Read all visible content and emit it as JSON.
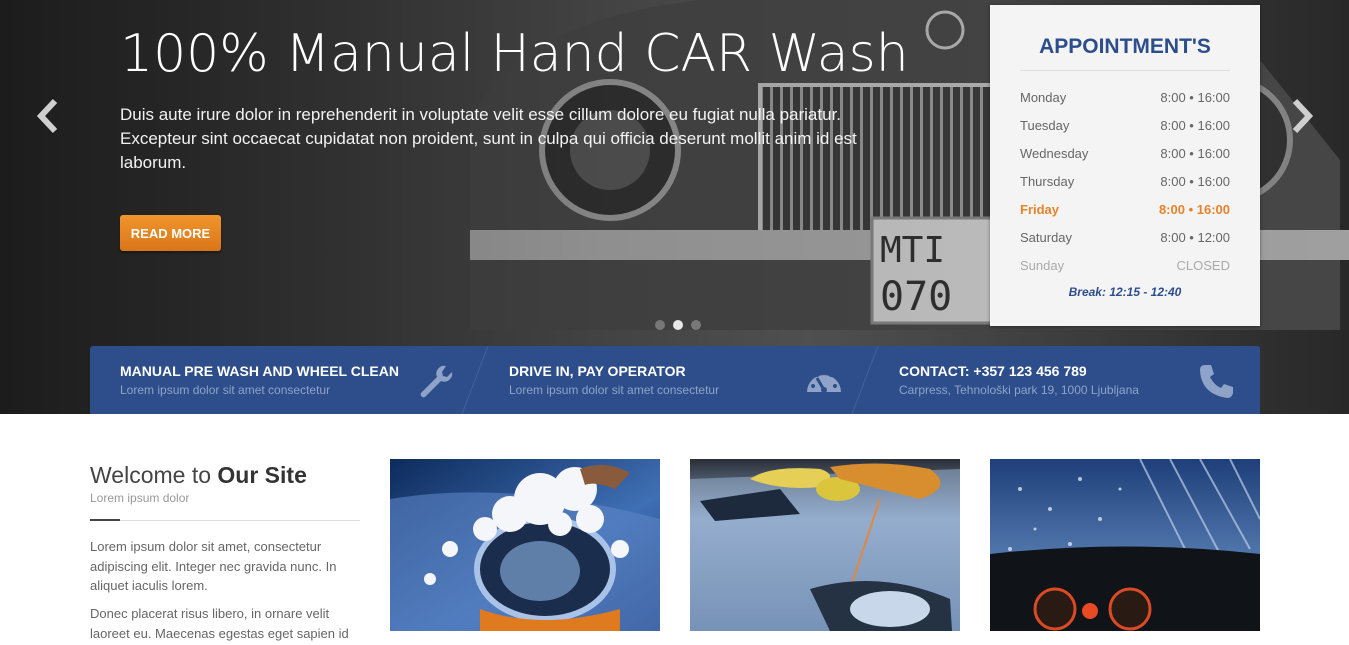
{
  "hero": {
    "title": "100% Manual Hand CAR Wash",
    "text": "Duis aute irure dolor in reprehenderit in voluptate velit esse cillum dolore eu fugiat nulla pariatur. Excepteur sint occaecat cupidatat non proident, sunt in culpa qui officia deserunt mollit anim id est laborum.",
    "button_label": "READ MORE",
    "slides": 3,
    "active_slide": 2,
    "background_image": "vintage-car-grille",
    "icons": {
      "prev": "chevron-left-icon",
      "next": "chevron-right-icon"
    }
  },
  "appointment": {
    "title": "APPOINTMENT'S",
    "days": [
      {
        "day": "Monday",
        "hours": "8:00 • 16:00"
      },
      {
        "day": "Tuesday",
        "hours": "8:00 • 16:00"
      },
      {
        "day": "Wednesday",
        "hours": "8:00 • 16:00"
      },
      {
        "day": "Thursday",
        "hours": "8:00 • 16:00"
      },
      {
        "day": "Friday",
        "hours": "8:00 • 16:00"
      },
      {
        "day": "Saturday",
        "hours": "8:00 • 12:00"
      },
      {
        "day": "Sunday",
        "hours": "CLOSED"
      }
    ],
    "highlight_day": "Friday",
    "closed_day": "Sunday",
    "break": "Break: 12:15 - 12:40"
  },
  "features": [
    {
      "title": "MANUAL PRE WASH AND WHEEL CLEAN",
      "subtitle": "Lorem ipsum dolor sit amet consectetur",
      "icon": "wrench-icon"
    },
    {
      "title": "DRIVE IN, PAY OPERATOR",
      "subtitle": "Lorem ipsum dolor sit amet consectetur",
      "icon": "speedometer-icon"
    },
    {
      "title": "CONTACT: +357 123 456 789",
      "subtitle": "Carpress, Tehnološki park 19, 1000 Ljubljana",
      "icon": "phone-icon"
    }
  ],
  "welcome": {
    "title_prefix": "Welcome to ",
    "title_bold": "Our Site",
    "subtitle": "Lorem ipsum dolor",
    "paragraphs": [
      "Lorem ipsum dolor sit amet, consectetur adipiscing elit. Integer nec gravida nunc. In aliquet iaculis lorem.",
      "Donec placerat risus libero, in ornare velit laoreet eu. Maecenas egestas eget sapien id"
    ]
  },
  "photos": [
    {
      "subject": "car-headlight-foam-wash"
    },
    {
      "subject": "car-hood-sponge-cloth"
    },
    {
      "subject": "windshield-car-wash-interior"
    }
  ],
  "colors": {
    "brand_blue": "#2d4e8b",
    "accent_orange": "#e5832a",
    "hero_overlay": "#2a2a2a"
  }
}
